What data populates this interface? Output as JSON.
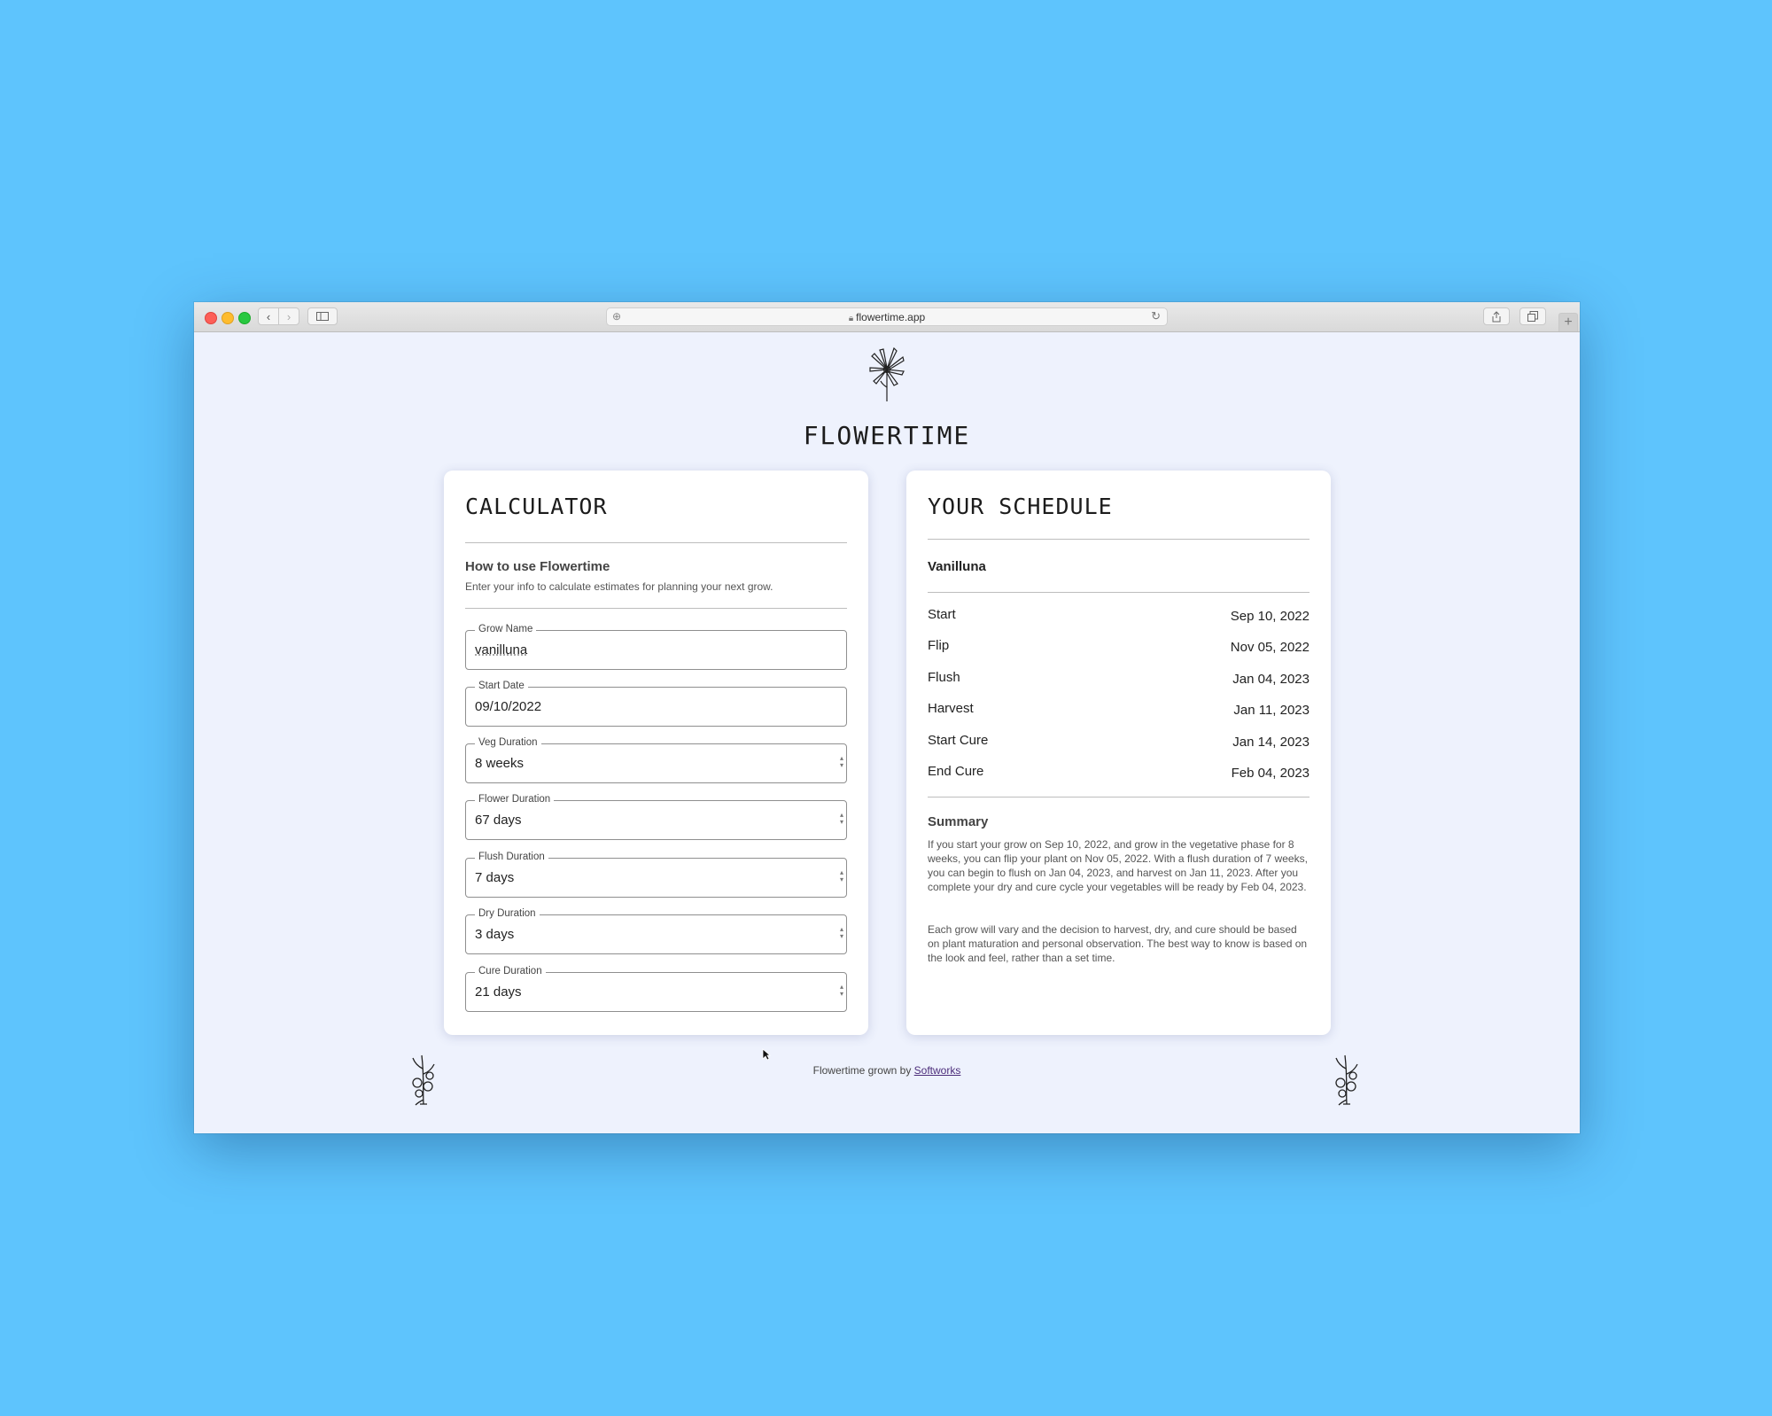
{
  "browser": {
    "url": "flowertime.app"
  },
  "site": {
    "title": "FLOWERTIME"
  },
  "calculator": {
    "title": "CALCULATOR",
    "howto_title": "How to use Flowertime",
    "howto_text": "Enter your info to calculate estimates for planning your next grow.",
    "fields": [
      {
        "label": "Grow Name",
        "value": "vanilluna"
      },
      {
        "label": "Start Date",
        "value": "09/10/2022"
      },
      {
        "label": "Veg Duration",
        "value": "8 weeks"
      },
      {
        "label": "Flower Duration",
        "value": "67 days"
      },
      {
        "label": "Flush Duration",
        "value": "7 days"
      },
      {
        "label": "Dry Duration",
        "value": "3 days"
      },
      {
        "label": "Cure Duration",
        "value": "21 days"
      }
    ]
  },
  "schedule": {
    "title": "YOUR SCHEDULE",
    "grow_name": "Vanilluna",
    "rows": [
      {
        "label": "Start",
        "date": "Sep 10, 2022"
      },
      {
        "label": "Flip",
        "date": "Nov 05, 2022"
      },
      {
        "label": "Flush",
        "date": "Jan 04, 2023"
      },
      {
        "label": "Harvest",
        "date": "Jan 11, 2023"
      },
      {
        "label": "Start Cure",
        "date": "Jan 14, 2023"
      },
      {
        "label": "End Cure",
        "date": "Feb 04, 2023"
      }
    ],
    "summary_title": "Summary",
    "summary_p1": "If you start your grow on Sep 10, 2022, and grow in the vegetative phase for 8 weeks, you can flip your plant on Nov 05, 2022. With a flush duration of 7 weeks, you can begin to flush on Jan 04, 2023, and harvest on Jan 11, 2023. After you complete your dry and cure cycle your vegetables will be ready by Feb 04, 2023.",
    "summary_p2": "Each grow will vary and the decision to harvest, dry, and cure should be based on plant maturation and personal observation. The best way to know is based on the look and feel, rather than a set time."
  },
  "footer": {
    "text": "Flowertime grown by",
    "link": "Softworks"
  }
}
